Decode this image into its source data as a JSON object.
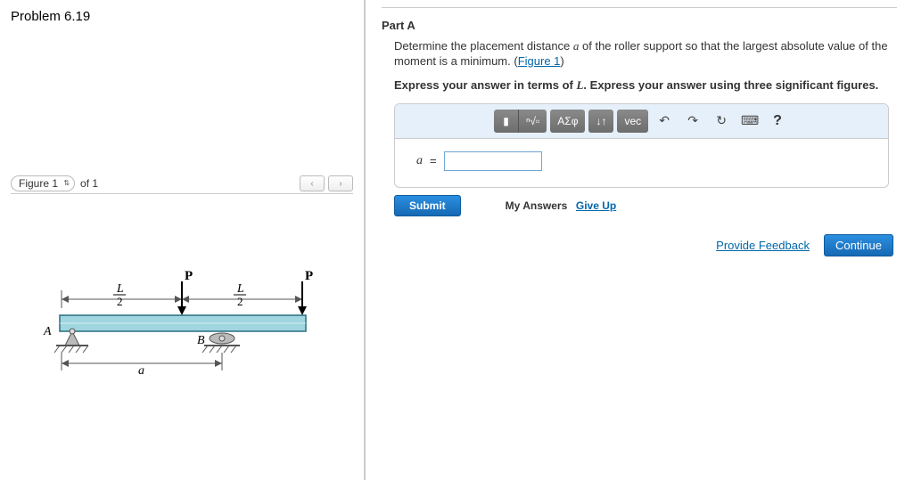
{
  "problem": {
    "title": "Problem 6.19"
  },
  "figure": {
    "selector_label": "Figure 1",
    "of_text": "of 1",
    "prev": "‹",
    "next": "›",
    "labels": {
      "P": "P",
      "Lhalf": "L",
      "two": "2",
      "A": "A",
      "B": "B",
      "a": "a"
    }
  },
  "part": {
    "title": "Part A",
    "prompt_pre": "Determine the placement distance ",
    "prompt_var": "a",
    "prompt_mid": " of the roller support so that the largest absolute value of the moment is a minimum. (",
    "figure_link": "Figure 1",
    "prompt_post": ")",
    "instruct_pre": "Express your answer in terms of ",
    "instruct_L": "L",
    "instruct_post": ". Express your answer using three significant figures."
  },
  "toolbar": {
    "templates": "▮",
    "radical": "ⁿ√▫",
    "greek": "ΑΣφ",
    "updown": "↓↑",
    "vec": "vec",
    "undo": "↶",
    "redo": "↷",
    "reset": "↻",
    "keyboard": "⌨",
    "help": "?"
  },
  "answer": {
    "label_var": "a",
    "equals": " = ",
    "value": ""
  },
  "actions": {
    "submit": "Submit",
    "my_answers": "My Answers",
    "give_up": "Give Up",
    "provide_feedback": "Provide Feedback",
    "continue": "Continue"
  }
}
